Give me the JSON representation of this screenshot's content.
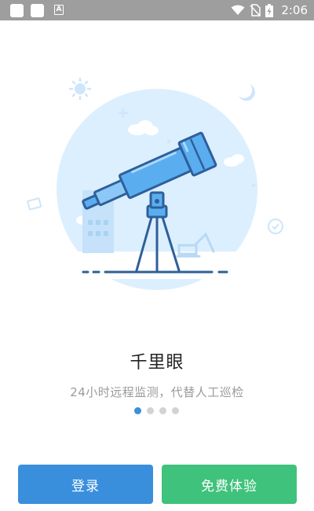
{
  "status_bar": {
    "time": "2:06",
    "notification_a_label": "A",
    "icons": [
      "notification-icon",
      "notification-icon",
      "a-icon",
      "wifi-icon",
      "no-sim-icon",
      "battery-charging-icon"
    ]
  },
  "onboarding": {
    "title": "千里眼",
    "subtitle": "24小时远程监测，代替人工巡检",
    "page_count": 4,
    "current_page": 1,
    "illustration_icon": "telescope-icon"
  },
  "actions": {
    "login_label": "登录",
    "trial_label": "免费体验"
  },
  "colors": {
    "primary_blue": "#3a8fdc",
    "primary_green": "#3fc27b",
    "dot_active": "#3d8fd8",
    "dot_inactive": "#d3d3d3",
    "illustration_bg": "#dcefff"
  }
}
